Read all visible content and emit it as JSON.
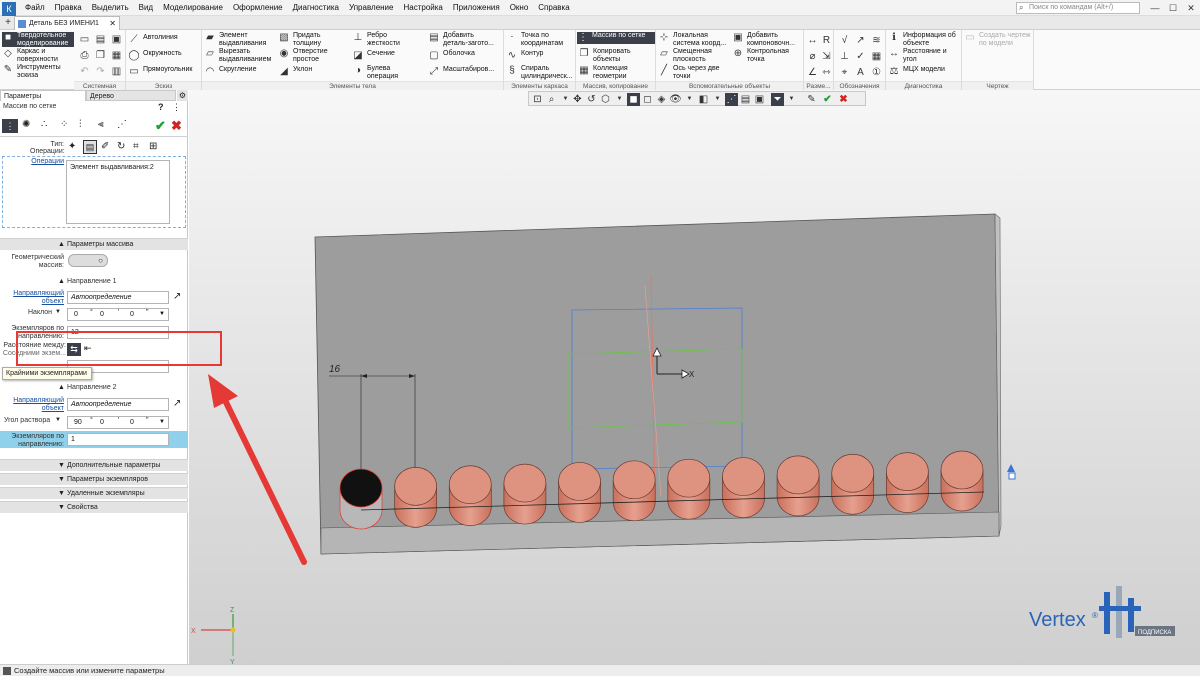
{
  "app": {
    "logo": "К"
  },
  "menu": [
    "Файл",
    "Правка",
    "Выделить",
    "Вид",
    "Моделирование",
    "Оформление",
    "Диагностика",
    "Управление",
    "Настройка",
    "Приложения",
    "Окно",
    "Справка"
  ],
  "search": {
    "placeholder": "Поиск по командам (Alt+/)"
  },
  "window_controls": [
    "—",
    "☐",
    "✕"
  ],
  "tabs": {
    "plus": "+",
    "doc_title": "Деталь БЕЗ ИМЕНИ1",
    "close": "✕"
  },
  "ribbon": {
    "left": {
      "items": [
        "Твердотельное\nмоделирование",
        "Каркас и\nповерхности",
        "Инструменты\nэскиза"
      ],
      "labels": [
        "Системная",
        "Эскиз"
      ]
    },
    "sketch": [
      "Автолиния",
      "Окружность",
      "Прямоугольник"
    ],
    "body_col1": [
      "Элемент\nвыдавливания",
      "Вырезать\nвыдавливанием",
      "Скругление"
    ],
    "body_col2": [
      "Придать\nтолщину",
      "Отверстие\nпростое",
      "Уклон"
    ],
    "body_col3": [
      "Ребро\nжесткости",
      "Сечение",
      "Булева\nоперация"
    ],
    "body_col4": [
      "Добавить\nдеталь-загото...",
      "Оболочка",
      "Масштабиров..."
    ],
    "body_label": "Элементы тела",
    "wire": [
      "Точка по\nкоординатам",
      "Контур",
      "Спираль\nцилиндрическ..."
    ],
    "wire_label": "Элементы каркаса",
    "array": [
      "Массив по сетке",
      "Копировать\nобъекты",
      "Коллекция\nгеометрии"
    ],
    "array_label": "Массив, копирование",
    "aux_col1": [
      "Локальная\nсистема коорд...",
      "Смещенная\nплоскость",
      "Ось через две\nточки"
    ],
    "aux_col2": [
      "Добавить\nкомпоновочн...",
      "Контрольная\nточка"
    ],
    "aux_label": "Вспомогательные объекты",
    "razm_label": "Разме...",
    "attr_label": "Обозначения",
    "diag": [
      "Информация об\nобъекте",
      "Расстояние и\nугол",
      "МЦХ модели"
    ],
    "diag_label": "Диагностика",
    "drawing": [
      "Создать чертеж\nпо модели"
    ],
    "drawing_label": "Чертеж"
  },
  "panel": {
    "tabs": [
      "Параметры",
      "Дерево"
    ],
    "op_title": "Массив по сетке",
    "help": "?",
    "type_label": "Тип:",
    "operations_label": "Операции:",
    "operations_link": "Операции",
    "operations_list": [
      "Элемент выдавливания:2"
    ],
    "sect_params": "Параметры массива",
    "geom_label": "Геометрический\nмассив:",
    "dir1": {
      "title": "Направление 1",
      "dir_obj_link": "Направляющий\nобъект",
      "dir_obj_value": "Автоопределение",
      "tilt_label": "Наклон",
      "tilt": [
        "0",
        "°",
        "0",
        "'",
        "0",
        "\""
      ],
      "count_label": "Экземпляров по\nнаправлению:",
      "count": "12",
      "dist_label": "Расстояние между:",
      "dist_sub": "Соседними экзем...",
      "tooltip": "Крайними экземплярами"
    },
    "dir2": {
      "title": "Направление 2",
      "dir_obj_link": "Направляющий\nобъект",
      "dir_obj_value": "Автоопределение",
      "angle_label": "Угол раствора",
      "angle": [
        "90",
        "°",
        "0",
        "'",
        "0",
        "\""
      ],
      "count_label": "Экземпляров по\nнаправлению:",
      "count": "1"
    },
    "sections": [
      "Дополнительные параметры",
      "Параметры экземпляров",
      "Удаленные экземпляры",
      "Свойства"
    ]
  },
  "viewport": {
    "dimension": "16",
    "axis_x": "X",
    "triad": {
      "x": "X",
      "y": "Y",
      "z": "Z"
    },
    "watermark": {
      "brand": "Vertex",
      "reg": "®",
      "sub": "ПОДПИСКА"
    },
    "cylinder_count": 12
  },
  "status": {
    "text": "Создайте массив или измените параметры"
  },
  "colors": {
    "accent_blue": "#2d6fb7",
    "highlight_red": "#e53935",
    "cylinder": "#d9826c",
    "plate": "#9a9a9a",
    "ok_green": "#1e9e3a",
    "cancel_red": "#d32222"
  }
}
